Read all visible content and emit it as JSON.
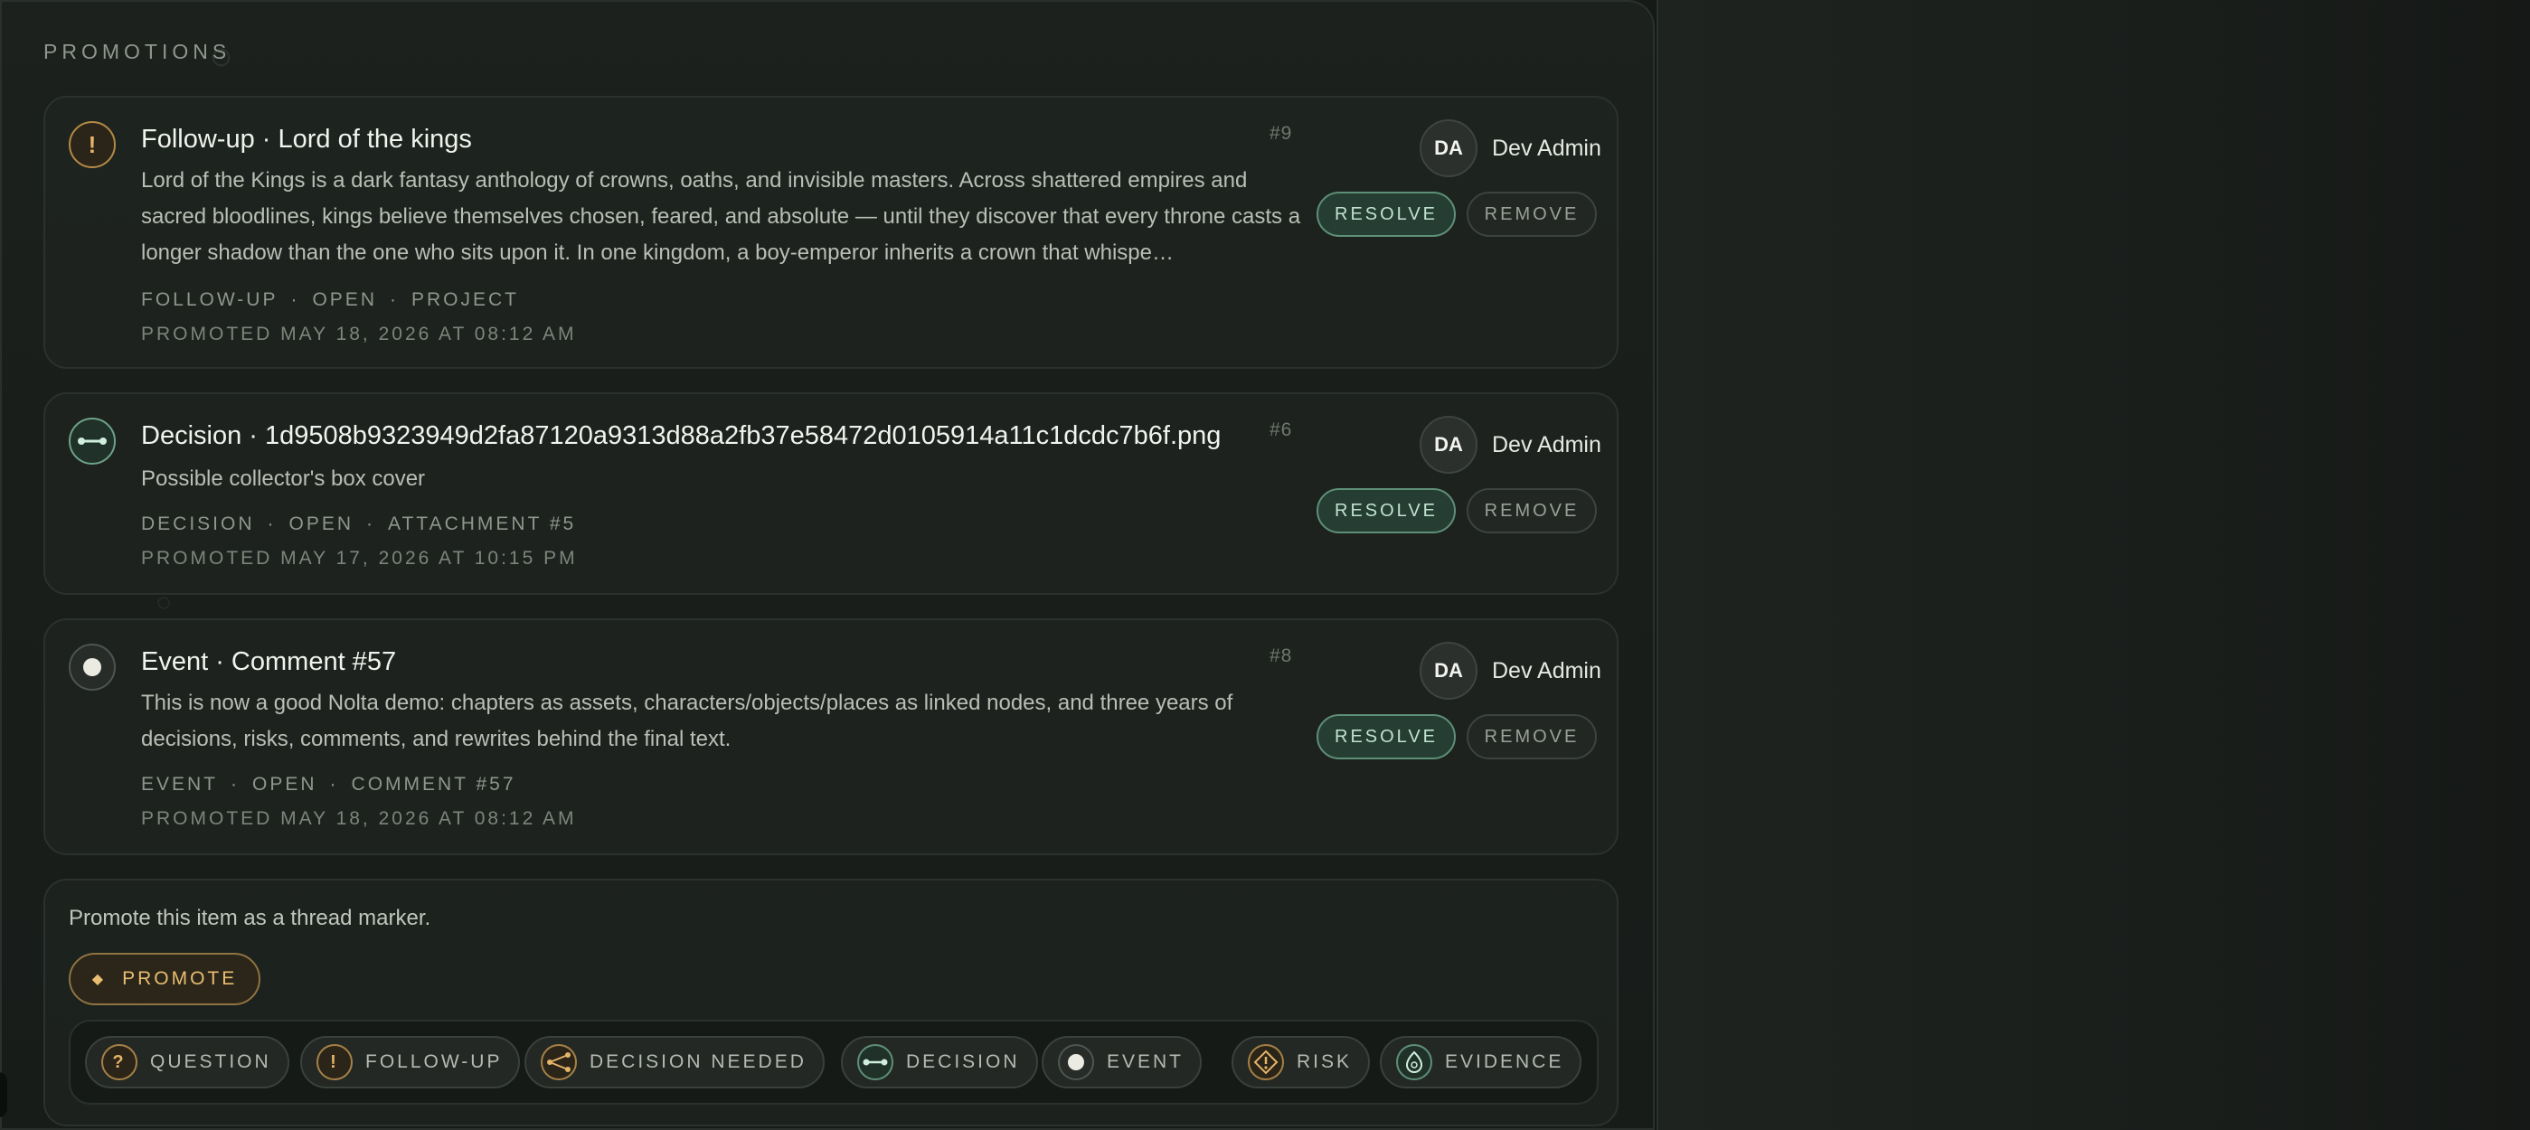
{
  "section": {
    "title": "PROMOTIONS"
  },
  "promotions": [
    {
      "number": "#9",
      "title": "Follow-up · Lord of the kings",
      "body": "Lord of the Kings is a dark fantasy anthology of crowns, oaths, and invisible masters. Across shattered empires and sacred bloodlines, kings believe themselves chosen, feared, and absolute — until they discover that every throne casts a longer shadow than the one who sits upon it. In one kingdom, a boy-emperor inherits a crown that whispe…",
      "meta": [
        "FOLLOW-UP",
        "OPEN",
        "PROJECT"
      ],
      "promoted": "PROMOTED MAY 18, 2026 AT 08:12 AM",
      "icon": "exclamation-icon",
      "avatar": "DA",
      "user": "Dev Admin",
      "resolve": "RESOLVE",
      "remove": "REMOVE"
    },
    {
      "number": "#6",
      "title": "Decision · 1d9508b9323949d2fa87120a9313d88a2fb37e58472d0105914a11c1dcdc7b6f.png",
      "body": "Possible collector's box cover",
      "meta": [
        "DECISION",
        "OPEN",
        "ATTACHMENT #5"
      ],
      "promoted": "PROMOTED MAY 17, 2026 AT 10:15 PM",
      "icon": "decision-icon",
      "avatar": "DA",
      "user": "Dev Admin",
      "resolve": "RESOLVE",
      "remove": "REMOVE"
    },
    {
      "number": "#8",
      "title": "Event · Comment #57",
      "body": "This is now a good Nolta demo: chapters as assets, characters/objects/places as linked nodes, and three years of decisions, risks, comments, and rewrites behind the final text.",
      "meta": [
        "EVENT",
        "OPEN",
        "COMMENT #57"
      ],
      "promoted": "PROMOTED MAY 18, 2026 AT 08:12 AM",
      "icon": "event-icon",
      "avatar": "DA",
      "user": "Dev Admin",
      "resolve": "RESOLVE",
      "remove": "REMOVE"
    }
  ],
  "promote": {
    "text": "Promote this item as a thread marker.",
    "button_label": "PROMOTE",
    "button_icon": "diamond-icon",
    "types": [
      {
        "label": "QUESTION",
        "icon": "question-icon"
      },
      {
        "label": "FOLLOW-UP",
        "icon": "exclamation-icon"
      },
      {
        "label": "DECISION NEEDED",
        "icon": "branch-icon"
      },
      {
        "label": "DECISION",
        "icon": "decision-icon"
      },
      {
        "label": "EVENT",
        "icon": "event-icon"
      },
      {
        "label": "RISK",
        "icon": "risk-icon"
      },
      {
        "label": "EVIDENCE",
        "icon": "evidence-icon"
      }
    ]
  },
  "colors": {
    "background": "#161a17",
    "accent_green": "#5e8f78",
    "accent_gold": "#e4b468",
    "text_primary": "#f1f3ee",
    "text_muted": "#8e968c"
  }
}
